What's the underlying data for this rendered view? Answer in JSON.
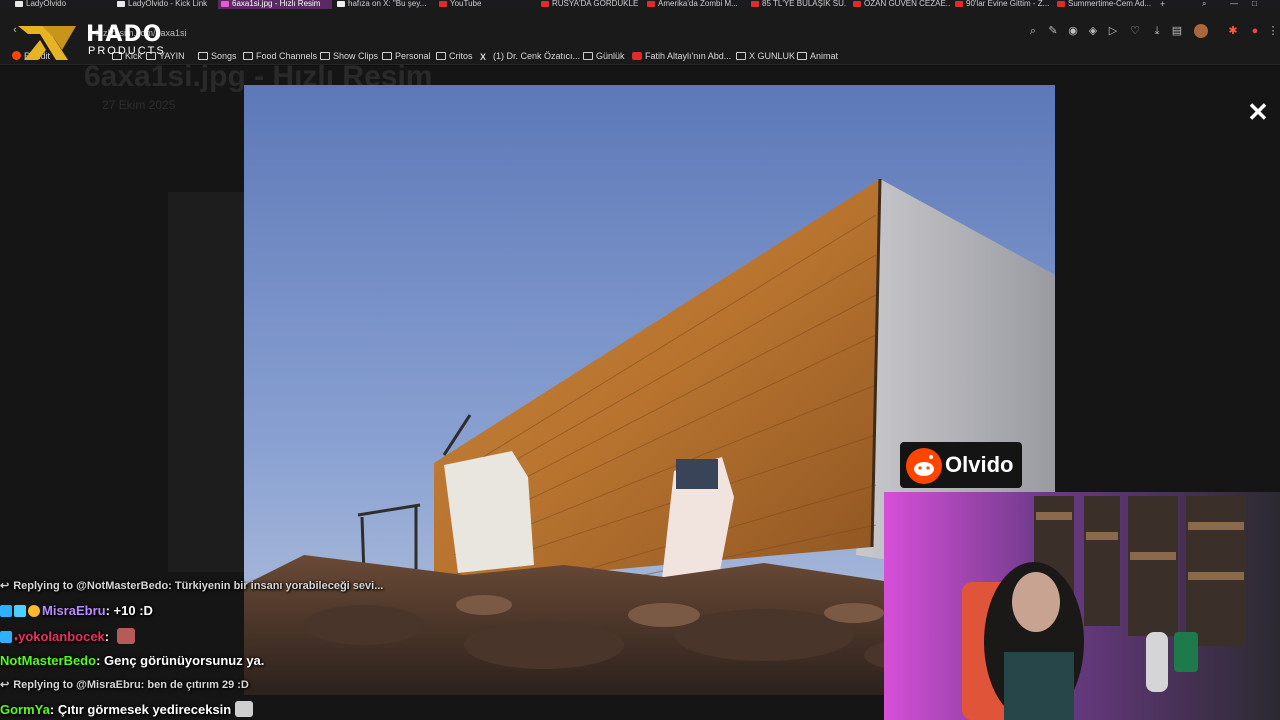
{
  "tabs": [
    {
      "label": "LadyOlvido"
    },
    {
      "label": "LadyOlvido - Kick Link"
    },
    {
      "label": "6axa1si.jpg - Hızlı Resim"
    },
    {
      "label": "hafıza on X: \"Bu şey..."
    },
    {
      "label": "YouTube"
    },
    {
      "label": "RUSYA'DA GÖRDÜKLE..."
    },
    {
      "label": "Amerika'da Zombi M..."
    },
    {
      "label": "85 TL'YE BULAŞIK SÜ..."
    },
    {
      "label": "OZAN GÜVEN CEZAE..."
    },
    {
      "label": "90'lar Evine Gittim - Z..."
    },
    {
      "label": "Summertime-Cem Ad..."
    }
  ],
  "address_bar": {
    "url": "hizliresim.com/6axa1si"
  },
  "bookmarks": [
    {
      "label": "Reddit",
      "kind": "reddit"
    },
    {
      "label": "Kick",
      "kind": "folder"
    },
    {
      "label": "YAYIN",
      "kind": "folder"
    },
    {
      "label": "Songs",
      "kind": "folder"
    },
    {
      "label": "Food Channels",
      "kind": "folder"
    },
    {
      "label": "Show Clips",
      "kind": "folder"
    },
    {
      "label": "Personal",
      "kind": "folder"
    },
    {
      "label": "Critos",
      "kind": "folder"
    },
    {
      "label": "(1) Dr. Cenk Özatıcı...",
      "kind": "x"
    },
    {
      "label": "Günlük",
      "kind": "folder"
    },
    {
      "label": "Fatih Altaylı'nın Abd...",
      "kind": "youtube"
    },
    {
      "label": "X GUNLUK",
      "kind": "folder"
    },
    {
      "label": "Animat",
      "kind": "folder"
    }
  ],
  "page": {
    "title": "6axa1si.jpg - Hızlı Resim",
    "date": "27 Ekim 2025"
  },
  "logo": {
    "brand": "HADO",
    "sub": "PRODUCTS"
  },
  "overlay": {
    "close_symbol": "✕"
  },
  "streamer_badge": {
    "name": "Olvido"
  },
  "chat": [
    {
      "type": "reply",
      "text": "Replying to @NotMasterBedo: Türkiyenin bir insanı yorabileceği sevi..."
    },
    {
      "user": "MisraEbru",
      "user_color": "#b98bff",
      "message": "+10 :D"
    },
    {
      "user": "yokolanbocek",
      "user_color": "#e8315b",
      "message": ""
    },
    {
      "user": "NotMasterBedo",
      "user_color": "#53fc18",
      "message": "Genç görünüyorsunuz ya."
    },
    {
      "type": "reply",
      "text": "Replying to @MisraEbru: ben de çıtırım 29 :D"
    },
    {
      "user": "GormYa",
      "user_color": "#53fc18",
      "message": "Çıtır görmesek yedireceksin"
    }
  ],
  "colors": {
    "accent_kick": "#53fc18",
    "active_tab": "#5a2a63",
    "reddit": "#ff4500"
  }
}
